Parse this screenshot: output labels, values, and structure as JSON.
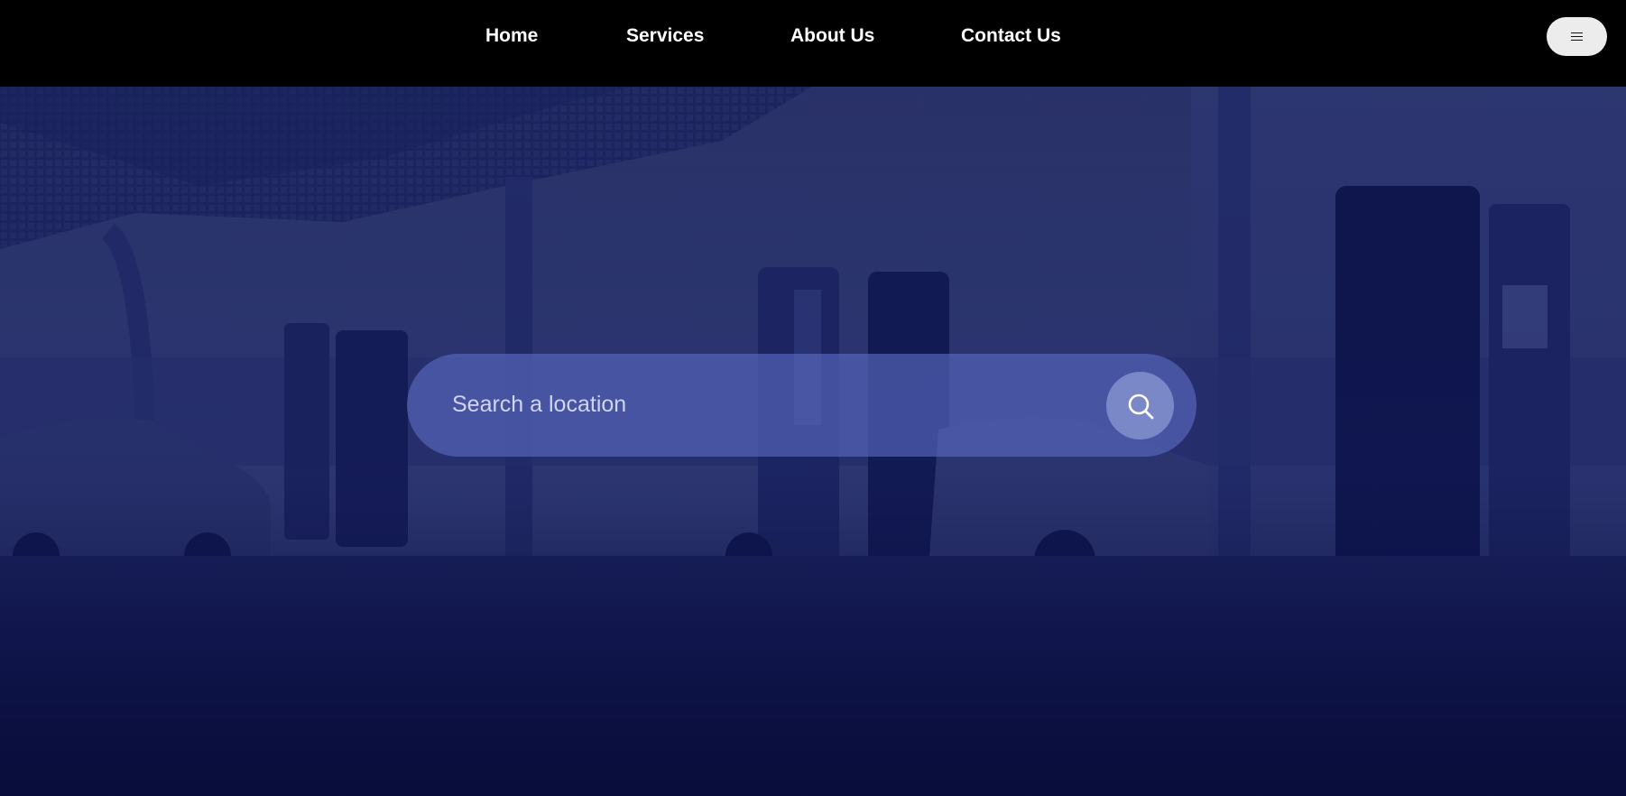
{
  "nav": {
    "items": [
      {
        "label": "Home"
      },
      {
        "label": "Services"
      },
      {
        "label": "About Us"
      },
      {
        "label": "Contact Us"
      }
    ],
    "menu_icon": "hamburger-icon"
  },
  "hero": {
    "background": "ev-charging-station-photo",
    "search": {
      "placeholder": "Search a location",
      "value": "",
      "button_icon": "search-icon"
    }
  },
  "colors": {
    "header_bg": "#000000",
    "overlay": "#10184f",
    "search_bar": "#5c6cc4",
    "search_button": "#8c9ad4",
    "menu_button": "#ececec"
  }
}
